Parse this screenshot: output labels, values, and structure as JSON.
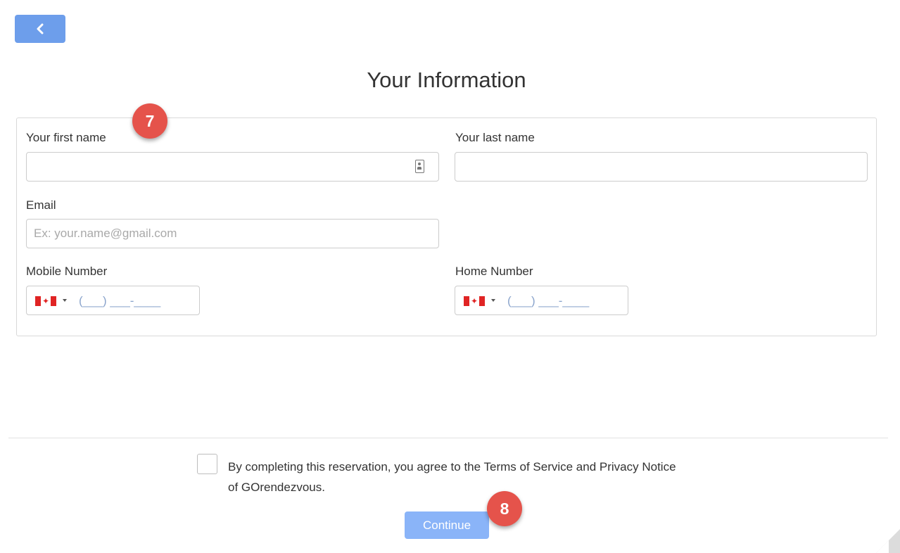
{
  "header": {
    "back_icon": "chevron-left-icon",
    "title": "Your Information"
  },
  "form": {
    "first_name": {
      "label": "Your first name",
      "value": "",
      "placeholder": ""
    },
    "last_name": {
      "label": "Your last name",
      "value": "",
      "placeholder": ""
    },
    "email": {
      "label": "Email",
      "value": "",
      "placeholder": "Ex: your.name@gmail.com"
    },
    "mobile": {
      "label": "Mobile Number",
      "country": "CA",
      "mask": "(___) ___-____"
    },
    "home": {
      "label": "Home Number",
      "country": "CA",
      "mask": "(___) ___-____"
    }
  },
  "footer": {
    "agree_text": "By completing this reservation, you agree to the Terms of Service and Privacy Notice of GOrendezvous.",
    "continue_label": "Continue"
  },
  "annotations": {
    "step_1": "7",
    "step_2": "8"
  },
  "colors": {
    "primary": "#6d9eeb",
    "button_disabled": "#8ab4f8",
    "badge": "#e5534b",
    "flag_red": "#e02424"
  }
}
